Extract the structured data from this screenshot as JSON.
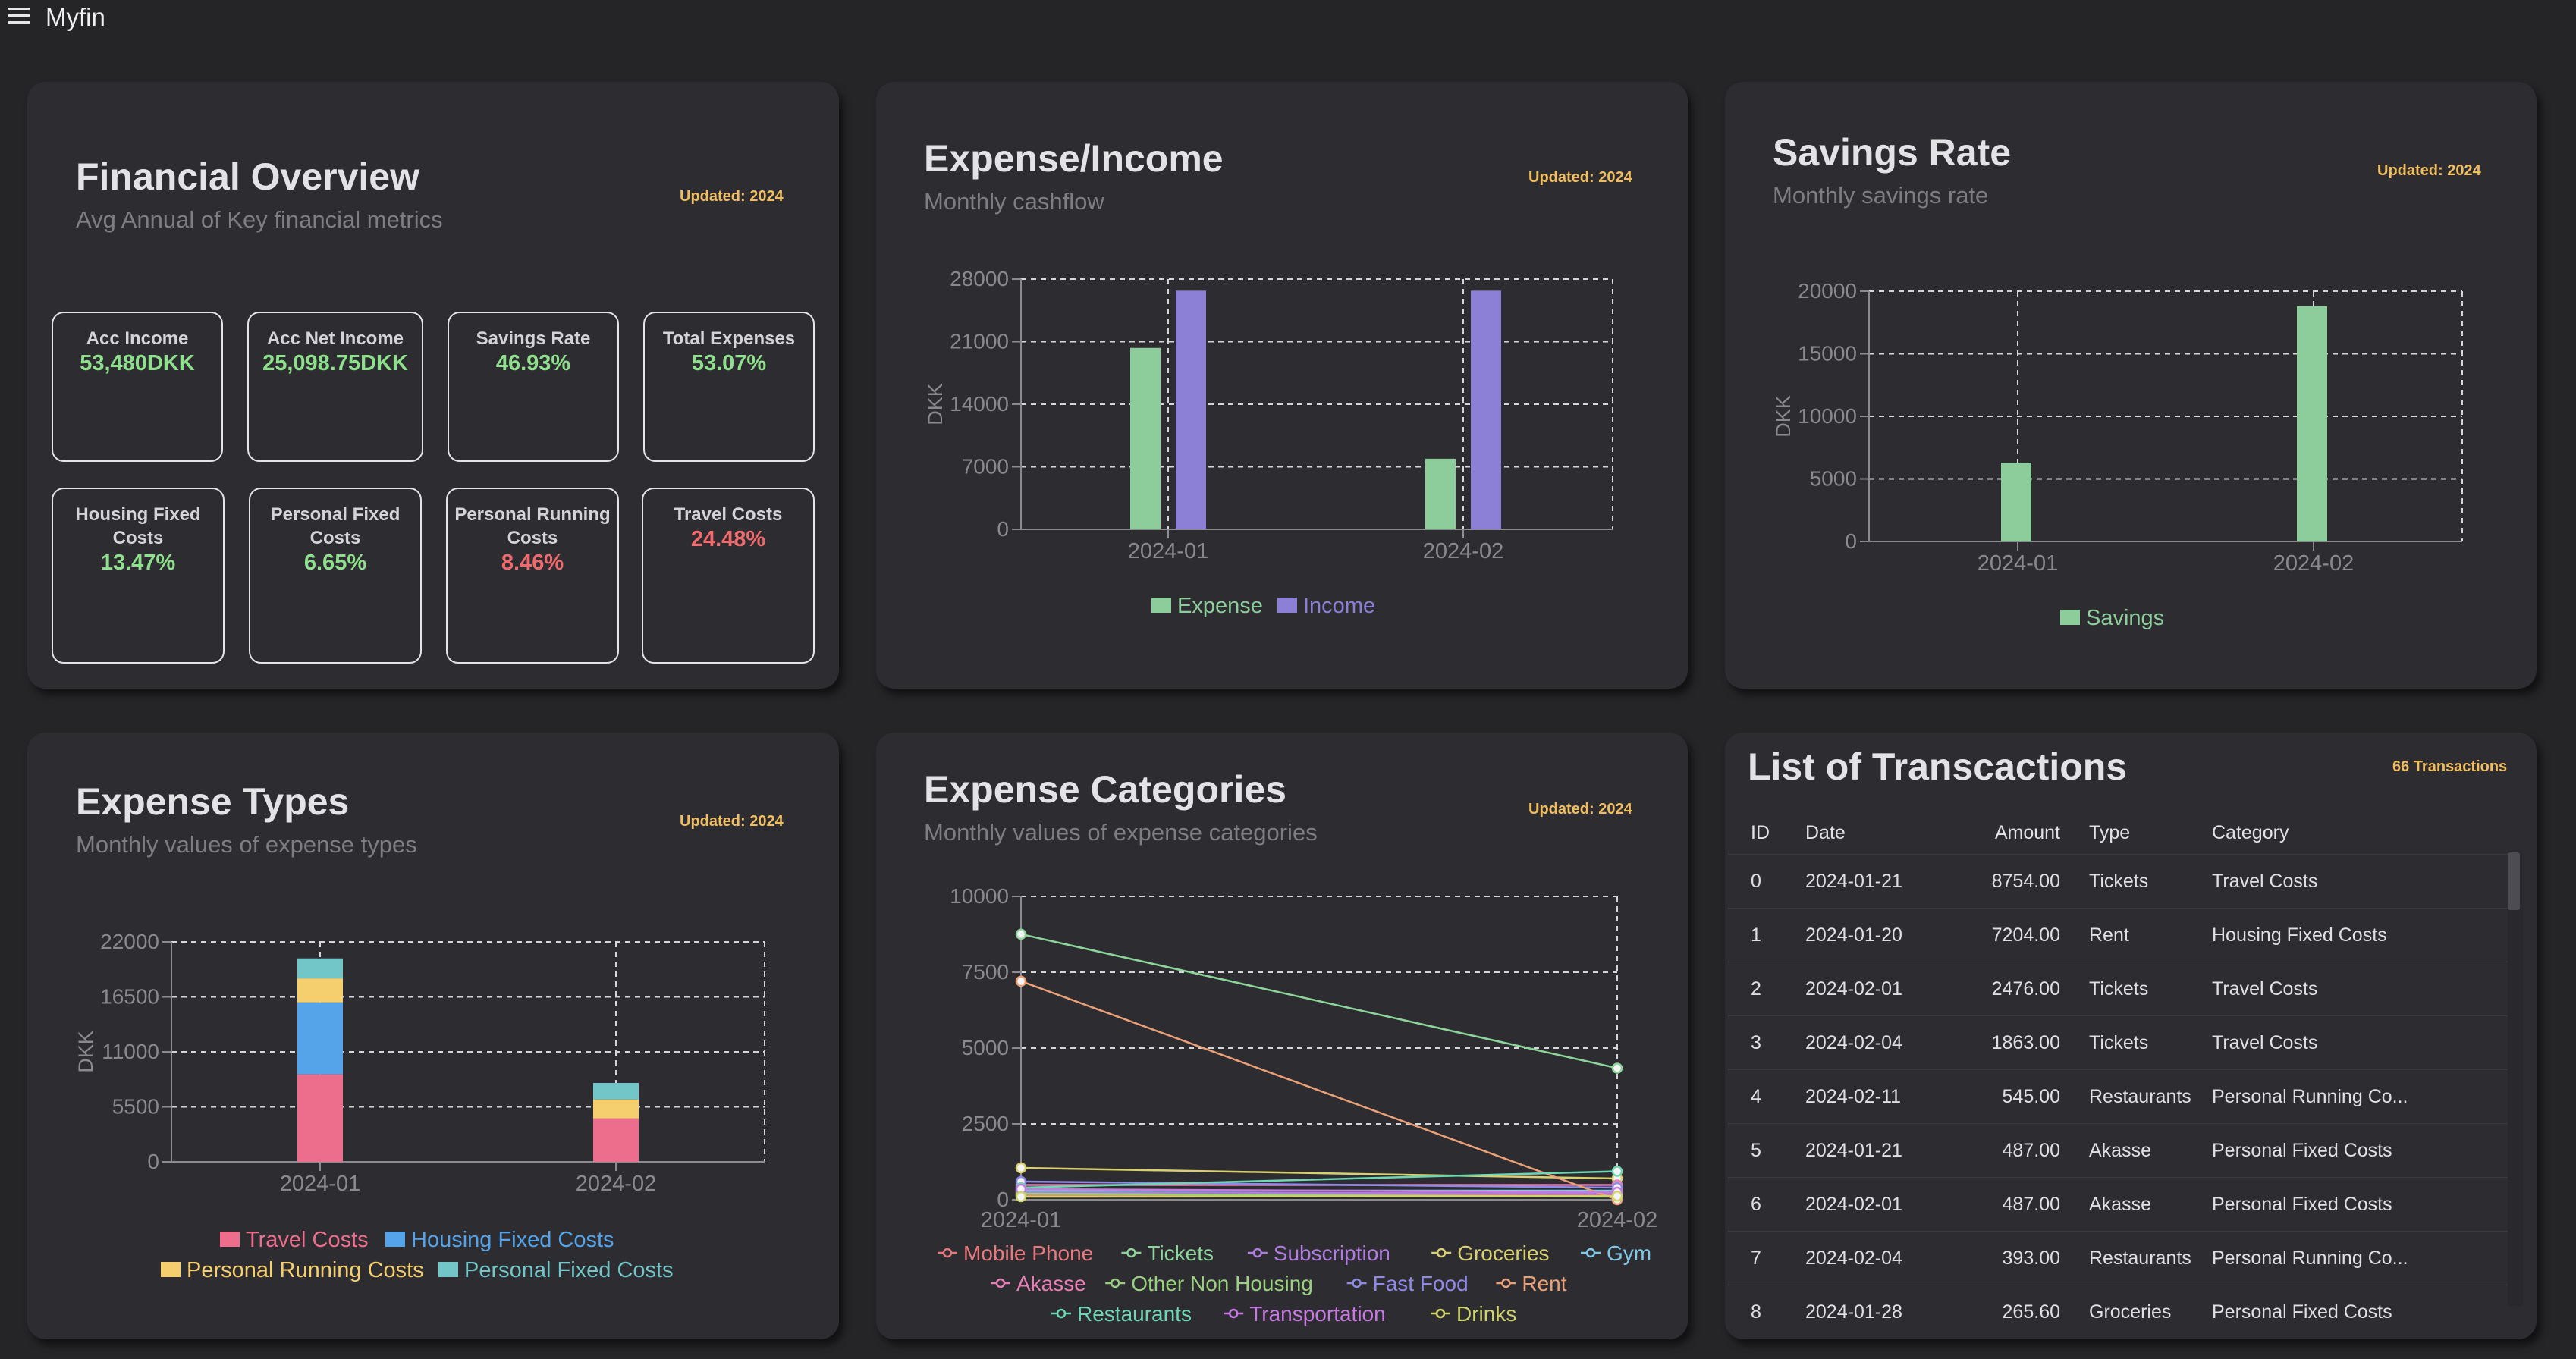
{
  "app": {
    "title": "Myfin",
    "menu_icon": "hamburger-menu-icon"
  },
  "colors": {
    "background": "#252528",
    "card": "#2d2c31",
    "positive": "#8fe08d",
    "negative": "#ef6a6c",
    "updated": "#f0bd5f",
    "expense": "#8dcc9b",
    "income": "#8b80d6",
    "travel": "#ec6e8c",
    "housing": "#55a3e8",
    "personal_running": "#f5cf6e",
    "personal_fixed": "#73c6c7"
  },
  "overview": {
    "title": "Financial Overview",
    "subtitle": "Avg Annual of Key financial metrics",
    "updated": "Updated: 2024",
    "metrics": [
      {
        "label": "Acc Income",
        "value": "53,480DKK",
        "tone": "positive"
      },
      {
        "label": "Acc Net Income",
        "value": "25,098.75DKK",
        "tone": "positive"
      },
      {
        "label": "Savings Rate",
        "value": "46.93%",
        "tone": "positive"
      },
      {
        "label": "Total Expenses",
        "value": "53.07%",
        "tone": "positive"
      },
      {
        "label": "Housing Fixed Costs",
        "value": "13.47%",
        "tone": "positive"
      },
      {
        "label": "Personal Fixed Costs",
        "value": "6.65%",
        "tone": "positive"
      },
      {
        "label": "Personal Running Costs",
        "value": "8.46%",
        "tone": "negative"
      },
      {
        "label": "Travel Costs",
        "value": "24.48%",
        "tone": "negative"
      }
    ]
  },
  "expense_income": {
    "title": "Expense/Income",
    "subtitle": "Monthly cashflow",
    "updated": "Updated: 2024",
    "ylabel": "DKK",
    "yticks": [
      "28000",
      "21000",
      "14000",
      "7000",
      "0"
    ],
    "categories": [
      "2024-01",
      "2024-02"
    ],
    "legend": [
      "Expense",
      "Income"
    ]
  },
  "savings": {
    "title": "Savings Rate",
    "subtitle": "Monthly savings rate",
    "updated": "Updated: 2024",
    "ylabel": "DKK",
    "yticks": [
      "20000",
      "15000",
      "10000",
      "5000",
      "0"
    ],
    "categories": [
      "2024-01",
      "2024-02"
    ],
    "legend": [
      "Savings"
    ]
  },
  "expense_types": {
    "title": "Expense Types",
    "subtitle": "Monthly values of expense types",
    "updated": "Updated: 2024",
    "ylabel": "DKK",
    "yticks": [
      "22000",
      "16500",
      "11000",
      "5500",
      "0"
    ],
    "categories": [
      "2024-01",
      "2024-02"
    ],
    "legend": [
      "Travel Costs",
      "Housing Fixed Costs",
      "Personal Running Costs",
      "Personal Fixed Costs"
    ]
  },
  "expense_categories": {
    "title": "Expense Categories",
    "subtitle": "Monthly values of expense categories",
    "updated": "Updated: 2024",
    "yticks": [
      "10000",
      "7500",
      "5000",
      "2500",
      "0"
    ],
    "categories": [
      "2024-01",
      "2024-02"
    ],
    "legend": [
      "Mobile Phone",
      "Tickets",
      "Subscription",
      "Groceries",
      "Gym",
      "Akasse",
      "Other Non Housing",
      "Fast Food",
      "Rent",
      "Restaurants",
      "Transportation",
      "Drinks"
    ]
  },
  "chart_data": [
    {
      "type": "bar",
      "title": "Expense/Income",
      "ylabel": "DKK",
      "categories": [
        "2024-01",
        "2024-02"
      ],
      "ylim": [
        0,
        28000
      ],
      "grid": true,
      "legend_position": "bottom",
      "series": [
        {
          "name": "Expense",
          "values": [
            20300,
            7900
          ],
          "color": "#8dcc9b"
        },
        {
          "name": "Income",
          "values": [
            26700,
            26700
          ],
          "color": "#8b80d6"
        }
      ]
    },
    {
      "type": "bar",
      "title": "Savings Rate",
      "ylabel": "DKK",
      "categories": [
        "2024-01",
        "2024-02"
      ],
      "ylim": [
        0,
        20000
      ],
      "grid": true,
      "legend_position": "bottom",
      "series": [
        {
          "name": "Savings",
          "values": [
            6300,
            18800
          ],
          "color": "#8dcc9b"
        }
      ]
    },
    {
      "type": "bar",
      "stacked": true,
      "title": "Expense Types",
      "ylabel": "DKK",
      "categories": [
        "2024-01",
        "2024-02"
      ],
      "ylim": [
        0,
        22000
      ],
      "grid": true,
      "legend_position": "bottom",
      "series": [
        {
          "name": "Travel Costs",
          "values": [
            8750,
            4340
          ],
          "color": "#ec6e8c"
        },
        {
          "name": "Housing Fixed Costs",
          "values": [
            7200,
            0
          ],
          "color": "#55a3e8"
        },
        {
          "name": "Personal Running Costs",
          "values": [
            2400,
            1900
          ],
          "color": "#f5cf6e"
        },
        {
          "name": "Personal Fixed Costs",
          "values": [
            2000,
            1650
          ],
          "color": "#73c6c7"
        }
      ]
    },
    {
      "type": "line",
      "title": "Expense Categories",
      "categories": [
        "2024-01",
        "2024-02"
      ],
      "ylim": [
        0,
        10000
      ],
      "grid": true,
      "legend_position": "bottom",
      "series": [
        {
          "name": "Mobile Phone",
          "values": [
            150,
            150
          ],
          "color": "#e8797f"
        },
        {
          "name": "Tickets",
          "values": [
            8754,
            4339
          ],
          "color": "#8dd69b"
        },
        {
          "name": "Subscription",
          "values": [
            250,
            200
          ],
          "color": "#b07ce0"
        },
        {
          "name": "Groceries",
          "values": [
            1050,
            700
          ],
          "color": "#d9d06f"
        },
        {
          "name": "Gym",
          "values": [
            300,
            300
          ],
          "color": "#7fc8e6"
        },
        {
          "name": "Akasse",
          "values": [
            487,
            487
          ],
          "color": "#e57fb6"
        },
        {
          "name": "Other Non Housing",
          "values": [
            200,
            100
          ],
          "color": "#9ad07e"
        },
        {
          "name": "Fast Food",
          "values": [
            600,
            400
          ],
          "color": "#8e8ae6"
        },
        {
          "name": "Rent",
          "values": [
            7204,
            0
          ],
          "color": "#eba177"
        },
        {
          "name": "Restaurants",
          "values": [
            400,
            938
          ],
          "color": "#6fd6b4"
        },
        {
          "name": "Transportation",
          "values": [
            350,
            250
          ],
          "color": "#c77be0"
        },
        {
          "name": "Drinks",
          "values": [
            100,
            120
          ],
          "color": "#cfd46c"
        }
      ]
    }
  ],
  "transactions": {
    "title": "List of Transcactions",
    "count": "66 Transactions",
    "columns": [
      "ID",
      "Date",
      "Amount",
      "Type",
      "Category"
    ],
    "rows": [
      [
        "0",
        "2024-01-21",
        "8754.00",
        "Tickets",
        "Travel Costs"
      ],
      [
        "1",
        "2024-01-20",
        "7204.00",
        "Rent",
        "Housing Fixed Costs"
      ],
      [
        "2",
        "2024-02-01",
        "2476.00",
        "Tickets",
        "Travel Costs"
      ],
      [
        "3",
        "2024-02-04",
        "1863.00",
        "Tickets",
        "Travel Costs"
      ],
      [
        "4",
        "2024-02-11",
        "545.00",
        "Restaurants",
        "Personal Running Co..."
      ],
      [
        "5",
        "2024-01-21",
        "487.00",
        "Akasse",
        "Personal Fixed Costs"
      ],
      [
        "6",
        "2024-02-01",
        "487.00",
        "Akasse",
        "Personal Fixed Costs"
      ],
      [
        "7",
        "2024-02-04",
        "393.00",
        "Restaurants",
        "Personal Running Co..."
      ],
      [
        "8",
        "2024-01-28",
        "265.60",
        "Groceries",
        "Personal Fixed Costs"
      ]
    ]
  }
}
